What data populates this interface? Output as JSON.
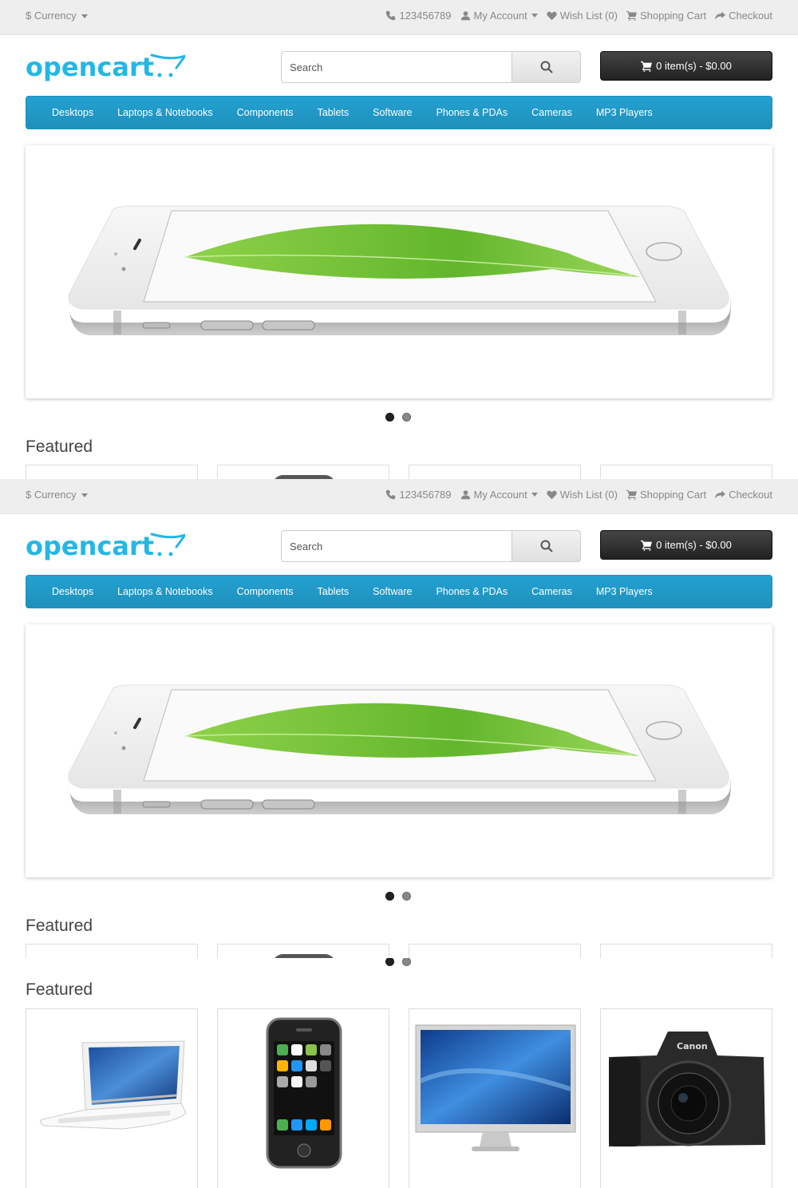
{
  "topbar": {
    "currency_symbol": "$",
    "currency_label": "Currency",
    "phone": "123456789",
    "my_account": "My Account",
    "wish_list": "Wish List (0)",
    "shopping_cart": "Shopping Cart",
    "checkout": "Checkout"
  },
  "header": {
    "logo_text": "opencart",
    "search_placeholder": "Search",
    "cart_label": "0 item(s) - $0.00"
  },
  "menu": {
    "items": [
      "Desktops",
      "Laptops & Notebooks",
      "Components",
      "Tablets",
      "Software",
      "Phones & PDAs",
      "Cameras",
      "MP3 Players"
    ]
  },
  "slideshow": {
    "slide_count": 2,
    "active_index": 0
  },
  "featured": {
    "title": "Featured",
    "products": [
      {
        "image": "macbook-laptop"
      },
      {
        "image": "iphone"
      },
      {
        "image": "apple-cinema-display"
      },
      {
        "image": "canon-eos-5d-camera"
      }
    ]
  },
  "colors": {
    "accent": "#229ac8",
    "logo": "#23b7e5",
    "topbar_bg": "#eeeeee",
    "cart_bg": "#303030"
  }
}
